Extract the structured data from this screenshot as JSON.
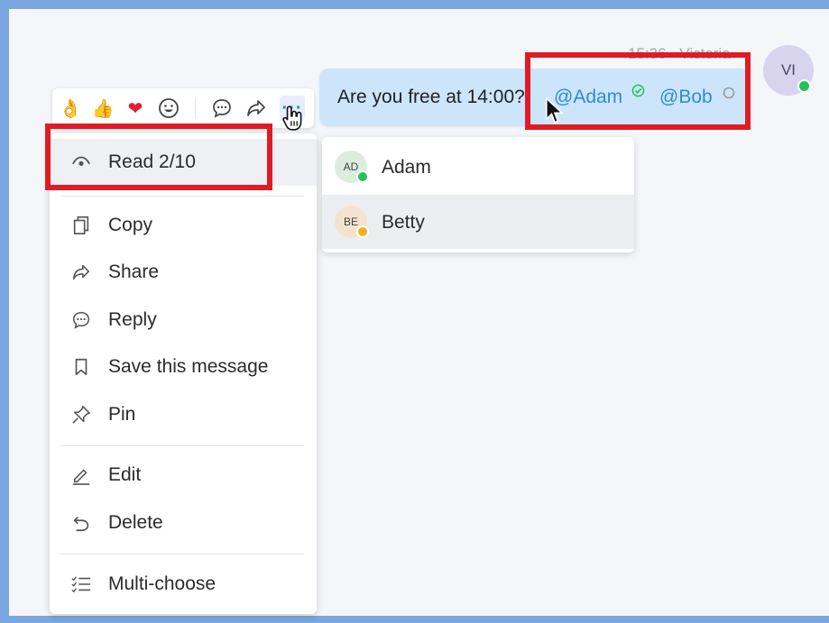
{
  "message": {
    "time": "15:36",
    "sender": "Victoria",
    "avatar_initials": "VI",
    "text": "Are you free at 14:00?",
    "mentions": [
      "@Adam",
      "@Bob"
    ]
  },
  "toolbar": {
    "reactions": [
      "👌",
      "👍",
      "❤",
      "😃"
    ],
    "more_label": "···"
  },
  "context_menu": {
    "items": [
      {
        "label": "Read 2/10",
        "icon": "eye-icon"
      },
      {
        "label": "Copy",
        "icon": "copy-icon"
      },
      {
        "label": "Share",
        "icon": "share-icon"
      },
      {
        "label": "Reply",
        "icon": "reply-icon"
      },
      {
        "label": "Save this message",
        "icon": "bookmark-icon"
      },
      {
        "label": "Pin",
        "icon": "pin-icon"
      },
      {
        "label": "Edit",
        "icon": "edit-icon"
      },
      {
        "label": "Delete",
        "icon": "undo-icon"
      },
      {
        "label": "Multi-choose",
        "icon": "checklist-icon"
      }
    ]
  },
  "mention_list": {
    "users": [
      {
        "initials": "AD",
        "name": "Adam",
        "status": "online",
        "status_color": "#23c25a",
        "avatar_color": "#dbeedd"
      },
      {
        "initials": "BE",
        "name": "Betty",
        "status": "away",
        "status_color": "#f2b01e",
        "avatar_color": "#f6e3cf"
      }
    ]
  },
  "colors": {
    "mention": "#2e8bd8",
    "highlight": "#e01b24",
    "bubble": "#cde5fa"
  }
}
